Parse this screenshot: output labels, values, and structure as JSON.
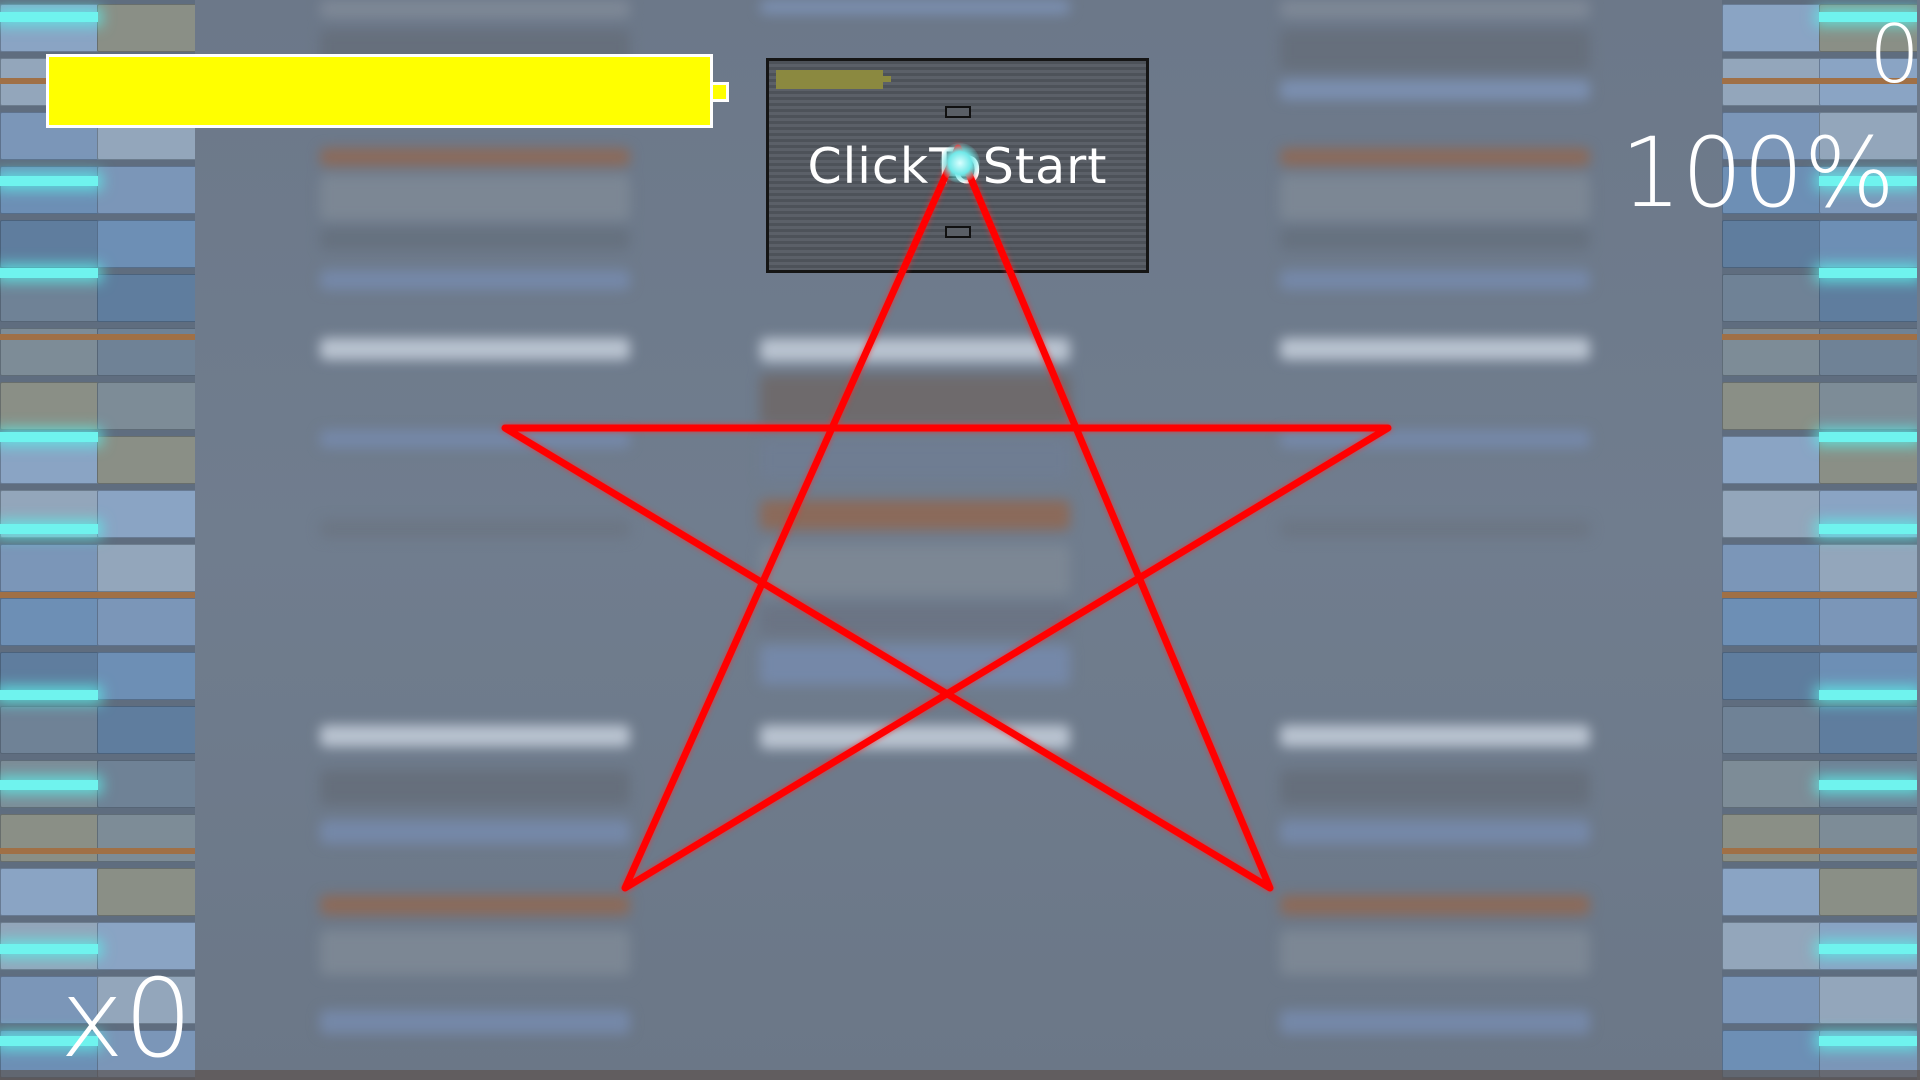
{
  "hud": {
    "score": "0",
    "accuracy": "100%",
    "combo": "x0",
    "energy_fraction": 1.0
  },
  "start_panel": {
    "label": "ClickToStart"
  },
  "drawing": {
    "shape": "star",
    "color": "#ff0000"
  },
  "colors": {
    "energy": "#ffff00",
    "note_glow": "#6ff3ee",
    "panel": "#4d5259"
  }
}
